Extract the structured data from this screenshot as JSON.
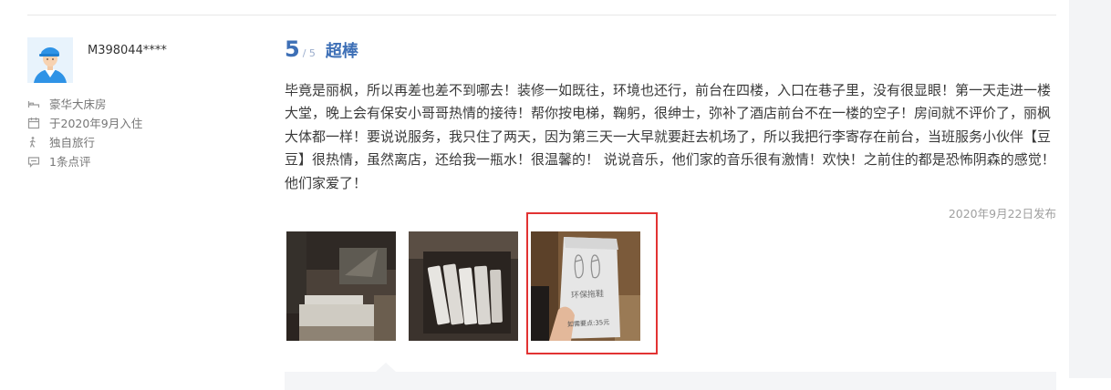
{
  "user": {
    "name": "M398044****",
    "room_type": "豪华大床房",
    "stay_date": "于2020年9月入住",
    "travel_type": "独自旅行",
    "review_count": "1条点评"
  },
  "rating": {
    "score": "5",
    "out_of": "/ 5",
    "label": "超棒"
  },
  "review": {
    "text": "毕竟是丽枫，所以再差也差不到哪去！装修一如既往，环境也还行，前台在四楼，入口在巷子里，没有很显眼！第一天走进一楼大堂，晚上会有保安小哥哥热情的接待！帮你按电梯，鞠躬，很绅士，弥补了酒店前台不在一楼的空子！房间就不评价了，丽枫大体都一样！要说说服务，我只住了两天，因为第三天一大早就要赶去机场了，所以我把行李寄存在前台，当班服务小伙伴【豆豆】很热情，虽然离店，还给我一瓶水！很温馨的！ 说说音乐，他们家的音乐很有激情！欢快！之前住的都是恐怖阴森的感觉！他们家爱了！",
    "date": "2020年9月22日发布"
  },
  "photos": [
    {
      "subject": "hotel-room-bed"
    },
    {
      "subject": "toiletries-box"
    },
    {
      "subject": "slippers-package",
      "label": "环保拖鞋",
      "price": "如需要点:35元"
    }
  ],
  "colors": {
    "accent": "#3d6fb6",
    "highlight": "#e23333"
  }
}
